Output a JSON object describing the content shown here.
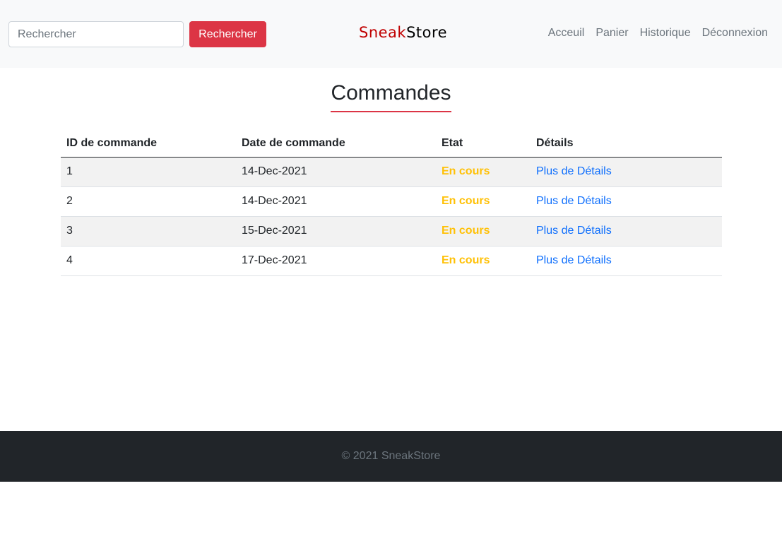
{
  "navbar": {
    "search": {
      "placeholder": "Rechercher",
      "value": "",
      "button_label": "Rechercher"
    },
    "brand": {
      "part1": "Sneak",
      "part2": "Store",
      "part1_color": "#c00000",
      "part2_color": "#000000"
    },
    "links": [
      "Acceuil",
      "Panier",
      "Historique",
      "Déconnexion"
    ]
  },
  "main": {
    "title": "Commandes",
    "table": {
      "headers": [
        "ID de commande",
        "Date de commande",
        "Etat",
        "Détails"
      ],
      "rows": [
        {
          "id": "1",
          "date": "14-Dec-2021",
          "status": "En cours",
          "details": "Plus de Détails"
        },
        {
          "id": "2",
          "date": "14-Dec-2021",
          "status": "En cours",
          "details": "Plus de Détails"
        },
        {
          "id": "3",
          "date": "15-Dec-2021",
          "status": "En cours",
          "details": "Plus de Détails"
        },
        {
          "id": "4",
          "date": "17-Dec-2021",
          "status": "En cours",
          "details": "Plus de Détails"
        }
      ]
    }
  },
  "footer": {
    "text": "© 2021 SneakStore"
  },
  "colors": {
    "accent": "#dc3545",
    "status_pending": "#ffc107",
    "link": "#0d6efd",
    "footer_bg": "#212529"
  }
}
